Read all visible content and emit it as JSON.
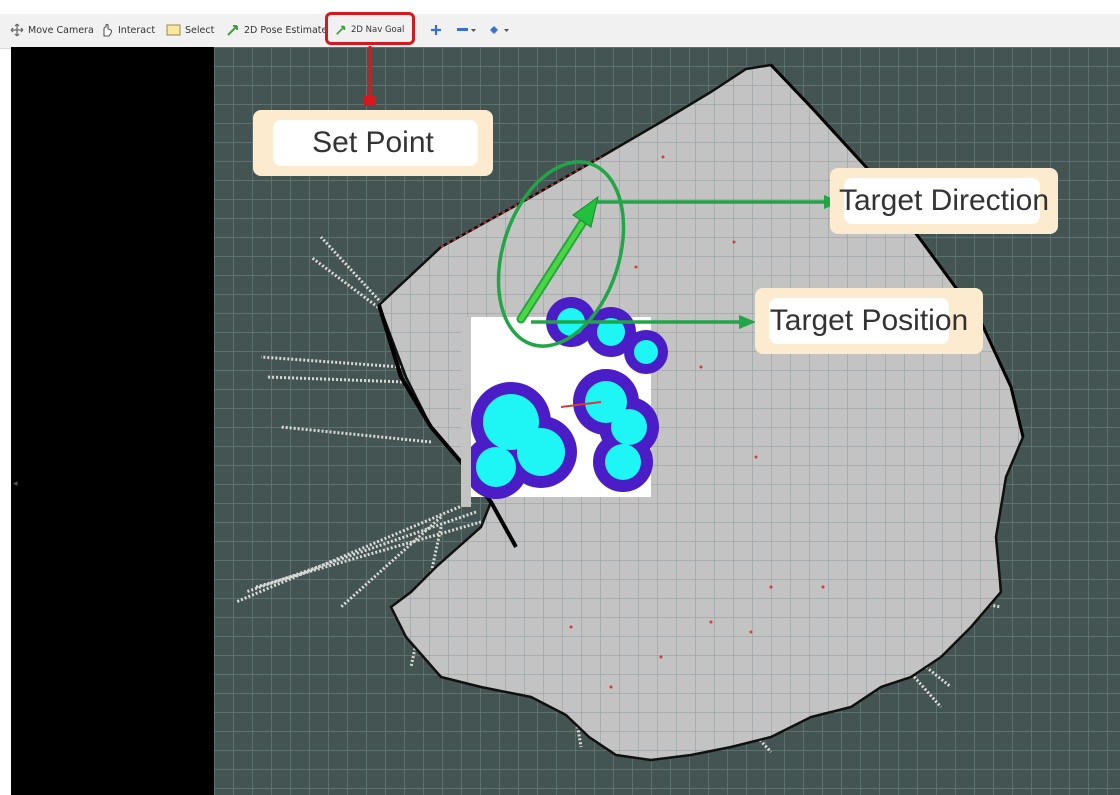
{
  "toolbar": {
    "items": [
      {
        "label": "Move Camera",
        "icon": "move-camera-icon"
      },
      {
        "label": "Interact",
        "icon": "interact-hand-icon"
      },
      {
        "label": "Select",
        "icon": "select-box-icon"
      },
      {
        "label": "2D Pose Estimate",
        "icon": "pose-arrow-icon"
      },
      {
        "label": "2D Nav Goal",
        "icon": "nav-goal-arrow-icon"
      }
    ],
    "extra_icons": [
      "crosshair-icon",
      "measure-dropdown-icon",
      "camera-view-dropdown-icon"
    ]
  },
  "annotations": {
    "set_point": "Set Point",
    "target_direction": "Target Direction",
    "target_position": "Target Position"
  },
  "colors": {
    "highlight_red": "#d7191f",
    "goal_green": "#22a547",
    "map_free": "#c3c3c3",
    "grid_background": "#435452",
    "costmap_cyan": "#1ef5f5",
    "costmap_purple": "#4b1dc7",
    "callout_bg": "#fdebd0"
  }
}
